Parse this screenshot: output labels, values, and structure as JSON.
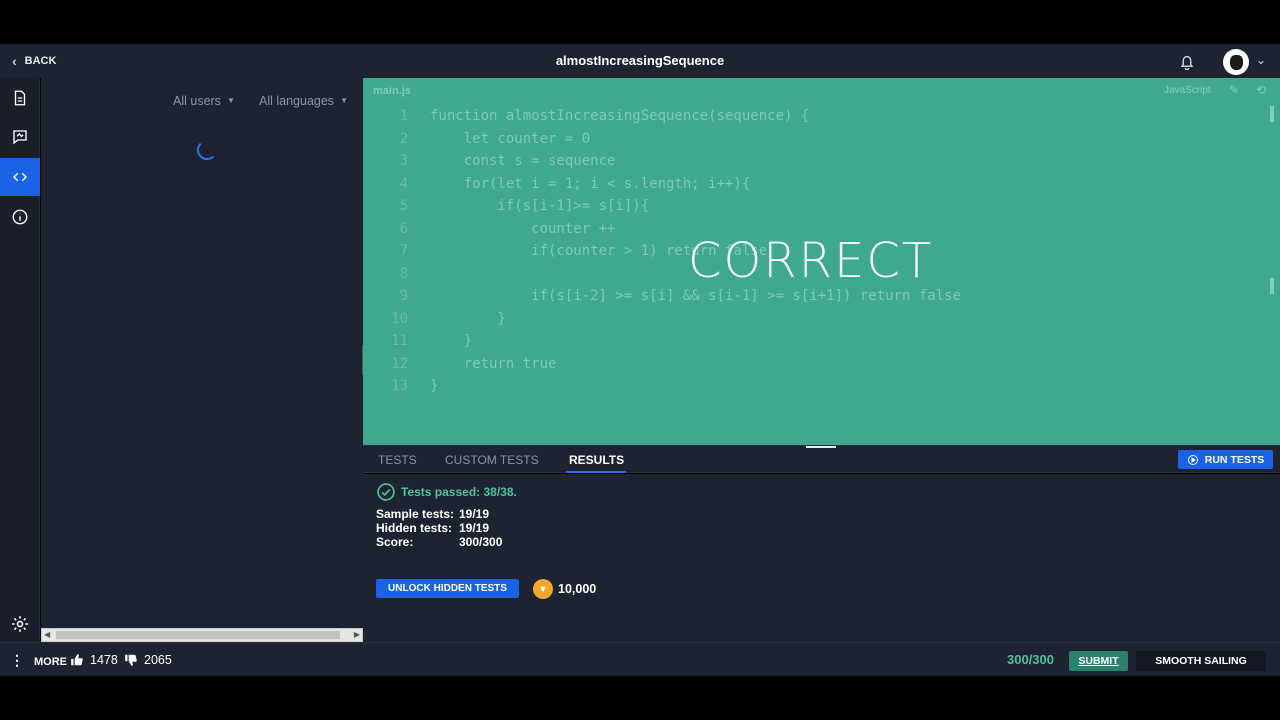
{
  "header": {
    "back_label": "BACK",
    "title": "almostIncreasingSequence"
  },
  "filters": {
    "users": "All users",
    "languages": "All languages"
  },
  "editor": {
    "filename": "main.js",
    "language": "JavaScript",
    "overlay": "CORRECT",
    "lines": [
      {
        "n": "1",
        "code": "function almostIncreasingSequence(sequence) {"
      },
      {
        "n": "2",
        "code": "    let counter = 0"
      },
      {
        "n": "3",
        "code": "    const s = sequence"
      },
      {
        "n": "4",
        "code": "    for(let i = 1; i < s.length; i++){"
      },
      {
        "n": "5",
        "code": "        if(s[i-1]>= s[i]){"
      },
      {
        "n": "6",
        "code": "            counter ++"
      },
      {
        "n": "7",
        "code": "            if(counter > 1) return false"
      },
      {
        "n": "8",
        "code": ""
      },
      {
        "n": "9",
        "code": "            if(s[i-2] >= s[i] && s[i-1] >= s[i+1]) return false"
      },
      {
        "n": "10",
        "code": "        }"
      },
      {
        "n": "11",
        "code": "    }"
      },
      {
        "n": "12",
        "code": "    return true"
      },
      {
        "n": "13",
        "code": "}"
      }
    ]
  },
  "tabs": {
    "tests": "TESTS",
    "custom_tests": "CUSTOM TESTS",
    "results": "RESULTS",
    "run_tests": "RUN TESTS"
  },
  "results": {
    "passed": "Tests passed: 38/38.",
    "sample_label": "Sample tests:",
    "sample_value": "19/19",
    "hidden_label": "Hidden tests:",
    "hidden_value": "19/19",
    "score_label": "Score:",
    "score_value": "300/300",
    "unlock_label": "UNLOCK HIDDEN TESTS",
    "cost": "10,000"
  },
  "footer": {
    "more": "MORE",
    "likes": "1478",
    "dislikes": "2065",
    "score": "300/300",
    "submit": "SUBMIT",
    "mode": "SMOOTH SAILING"
  },
  "colors": {
    "accent_blue": "#1a62e6",
    "success_green": "#4fc1a0",
    "editor_overlay": "#3fa88f"
  }
}
